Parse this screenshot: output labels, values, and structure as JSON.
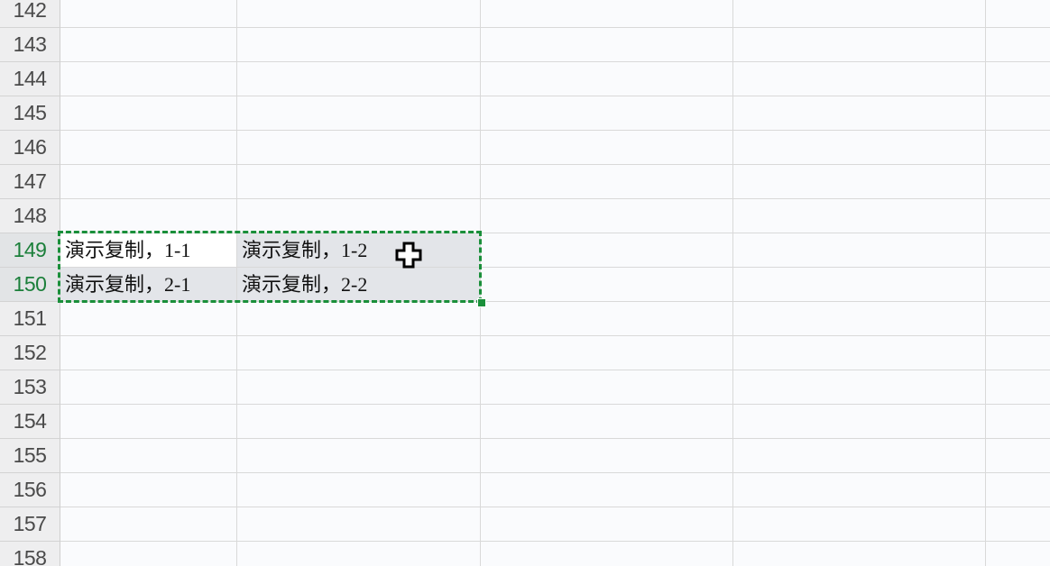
{
  "sheet": {
    "row_numbers": [
      "142",
      "143",
      "144",
      "145",
      "146",
      "147",
      "148",
      "149",
      "150",
      "151",
      "152",
      "153",
      "154",
      "155",
      "156",
      "157",
      "158"
    ],
    "selected_rows": [
      "149",
      "150"
    ],
    "cells": {
      "r149": {
        "a": "演示复制，1-1",
        "b": "演示复制，1-2"
      },
      "r150": {
        "a": "演示复制，2-1",
        "b": "演示复制，2-2"
      }
    }
  },
  "colors": {
    "selection_border": "#1a8f3a",
    "selected_row_header_text": "#1b7f3a",
    "grid_line": "#d9d9d9"
  },
  "cursor": {
    "icon": "cell-select-cross-cursor-icon"
  }
}
